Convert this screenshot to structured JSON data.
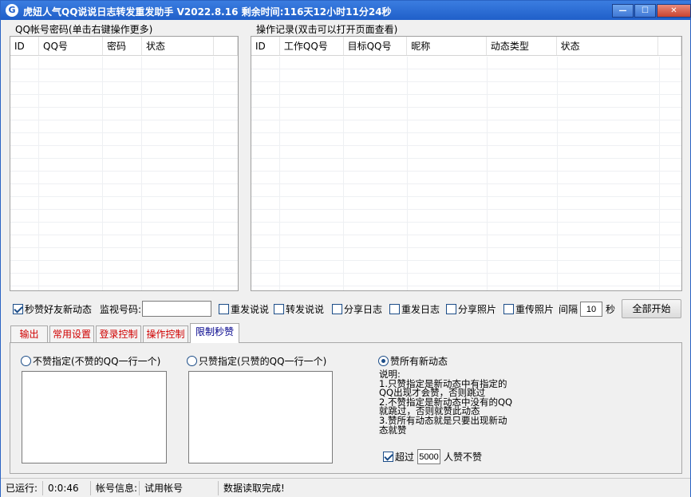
{
  "window": {
    "title": "虎妞人气QQ说说日志转发重发助手 V2022.8.16 剩余时间:116天12小时11分24秒",
    "app_icon": "G",
    "minimize_glyph": "—",
    "maximize_glyph": "☐",
    "close_glyph": "✕"
  },
  "accounts": {
    "title": "QQ帐号密码(单击右键操作更多)",
    "columns": [
      "ID",
      "QQ号",
      "密码",
      "状态"
    ]
  },
  "records": {
    "title": "操作记录(双击可以打开页面查看)",
    "columns": [
      "ID",
      "工作QQ号",
      "目标QQ号",
      "昵称",
      "动态类型",
      "状态"
    ]
  },
  "options": {
    "like_friends": {
      "label": "秒赞好友新动态",
      "checked": true
    },
    "monitor_label": "监视号码:",
    "monitor_value": "",
    "repost_shuoshuo": {
      "label": "重发说说",
      "checked": false
    },
    "forward_shuoshuo": {
      "label": "转发说说",
      "checked": false
    },
    "share_log": {
      "label": "分享日志",
      "checked": false
    },
    "repost_log": {
      "label": "重发日志",
      "checked": false
    },
    "share_photo": {
      "label": "分享照片",
      "checked": false
    },
    "reupload_photo": {
      "label": "重传照片",
      "checked": false
    },
    "interval_label": "间隔",
    "interval_value": "10",
    "interval_unit": "秒",
    "start_all": "全部开始"
  },
  "tabs": [
    {
      "label": "输出"
    },
    {
      "label": "常用设置"
    },
    {
      "label": "登录控制"
    },
    {
      "label": "操作控制"
    },
    {
      "label": "限制秒赞",
      "active": true
    }
  ],
  "panel": {
    "radio_no_like": {
      "label": "不赞指定(不赞的QQ一行一个)",
      "checked": false
    },
    "radio_only_like": {
      "label": "只赞指定(只赞的QQ一行一个)",
      "checked": false
    },
    "radio_like_all": {
      "label": "赞所有新动态",
      "checked": true
    },
    "description": "说明:\n1.只赞指定是新动态中有指定的\nQQ出现才会赞，否则跳过\n2.不赞指定是新动态中没有的QQ\n就跳过，否则就赞此动态\n3.赞所有动态就是只要出现新动\n态就赞",
    "over_check": {
      "label": "超过",
      "checked": true
    },
    "over_value": "5000",
    "over_suffix": "人赞不赞"
  },
  "status": {
    "running_label": "已运行:",
    "running_value": "0:0:46",
    "account_label": "帐号信息:",
    "account_value": "试用帐号",
    "message": "数据读取完成!"
  }
}
